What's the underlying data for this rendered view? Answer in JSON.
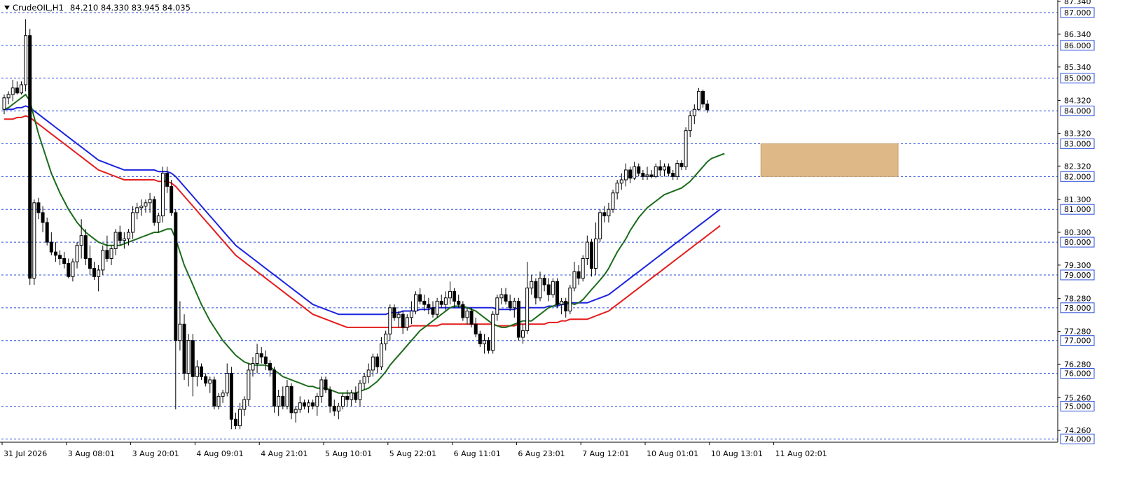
{
  "header": {
    "symbol": "CrudeOIL,H1",
    "ohlc": "84.210 84.330 83.945 84.035"
  },
  "colors": {
    "background": "#ffffff",
    "grid": "#2b4fd6",
    "candle_border": "#000000",
    "bull_body": "#ffffff",
    "bear_body": "#000000",
    "ma_fast": "#1a6b1a",
    "ma_mid": "#1c24e0",
    "ma_slow": "#e51c1c",
    "zone": "#deb887"
  },
  "chart_data": {
    "type": "candlestick",
    "ylim": [
      73.9,
      87.34
    ],
    "y_labels_plain": [
      "87.340",
      "86.340",
      "85.340",
      "84.320",
      "83.320",
      "82.320",
      "81.300",
      "80.300",
      "79.300",
      "78.280",
      "77.280",
      "76.280",
      "75.260",
      "74.260"
    ],
    "y_labels_boxed": [
      "87.000",
      "86.000",
      "85.000",
      "84.000",
      "83.000",
      "82.000",
      "81.000",
      "80.000",
      "79.000",
      "78.000",
      "77.000",
      "76.000",
      "75.000",
      "74.000"
    ],
    "grid_levels": [
      87,
      86,
      85,
      84,
      83,
      82,
      81,
      80,
      79,
      78,
      77,
      76,
      75,
      74
    ],
    "x_labels": [
      "31 Jul 2026",
      "3 Aug 08:01",
      "3 Aug 20:01",
      "4 Aug 09:01",
      "4 Aug 21:01",
      "5 Aug 10:01",
      "5 Aug 22:01",
      "6 Aug 11:01",
      "6 Aug 23:01",
      "7 Aug 12:01",
      "10 Aug 01:01",
      "10 Aug 13:01",
      "11 Aug 02:01"
    ],
    "x_label_bar_index": [
      0,
      15,
      30,
      45,
      60,
      75,
      90,
      105,
      120,
      135,
      150,
      165,
      180
    ],
    "zone": {
      "bar_from": 177,
      "bar_to": 209,
      "low": 82.0,
      "high": 83.0
    },
    "candles": [
      [
        84.05,
        84.5,
        83.9,
        84.4
      ],
      [
        84.4,
        84.6,
        84.2,
        84.5
      ],
      [
        84.5,
        84.95,
        84.3,
        84.7
      ],
      [
        84.7,
        84.9,
        84.5,
        84.55
      ],
      [
        84.55,
        84.9,
        84.5,
        84.8
      ],
      [
        84.8,
        86.8,
        84.6,
        86.3
      ],
      [
        86.3,
        86.5,
        78.7,
        78.9
      ],
      [
        78.9,
        81.3,
        78.7,
        81.2
      ],
      [
        81.2,
        81.35,
        80.7,
        80.9
      ],
      [
        80.9,
        81.1,
        80.3,
        80.6
      ],
      [
        80.6,
        80.75,
        79.9,
        80.0
      ],
      [
        80.0,
        80.3,
        79.6,
        79.7
      ],
      [
        79.7,
        80.0,
        79.4,
        79.6
      ],
      [
        79.6,
        79.75,
        79.3,
        79.5
      ],
      [
        79.5,
        79.7,
        79.2,
        79.35
      ],
      [
        79.35,
        79.5,
        78.9,
        78.95
      ],
      [
        78.95,
        79.5,
        78.8,
        79.4
      ],
      [
        79.4,
        80.0,
        79.2,
        79.9
      ],
      [
        79.9,
        80.7,
        79.5,
        80.2
      ],
      [
        80.2,
        80.4,
        79.3,
        79.5
      ],
      [
        79.5,
        79.9,
        79.0,
        79.2
      ],
      [
        79.2,
        79.4,
        78.85,
        78.95
      ],
      [
        78.95,
        79.3,
        78.5,
        79.15
      ],
      [
        79.15,
        79.9,
        79.0,
        79.75
      ],
      [
        79.75,
        80.2,
        79.4,
        79.5
      ],
      [
        79.5,
        79.9,
        79.3,
        79.8
      ],
      [
        79.8,
        80.4,
        79.6,
        80.3
      ],
      [
        80.3,
        80.5,
        79.9,
        80.05
      ],
      [
        80.05,
        80.3,
        79.8,
        80.1
      ],
      [
        80.1,
        80.4,
        79.9,
        80.3
      ],
      [
        80.3,
        81.1,
        80.1,
        80.9
      ],
      [
        80.9,
        81.2,
        80.7,
        81.05
      ],
      [
        81.05,
        81.3,
        80.8,
        81.1
      ],
      [
        81.1,
        81.3,
        80.9,
        81.2
      ],
      [
        81.2,
        81.5,
        80.9,
        81.3
      ],
      [
        81.3,
        81.4,
        80.5,
        80.6
      ],
      [
        80.6,
        80.9,
        80.3,
        80.8
      ],
      [
        80.8,
        82.3,
        80.6,
        82.1
      ],
      [
        82.1,
        82.3,
        81.5,
        81.7
      ],
      [
        81.7,
        81.9,
        80.8,
        80.9
      ],
      [
        80.9,
        81.0,
        74.9,
        77.0
      ],
      [
        77.0,
        78.2,
        76.7,
        77.5
      ],
      [
        77.5,
        77.8,
        75.8,
        76.0
      ],
      [
        76.0,
        77.2,
        75.6,
        77.0
      ],
      [
        77.0,
        77.2,
        75.3,
        75.9
      ],
      [
        75.9,
        76.4,
        75.6,
        76.2
      ],
      [
        76.2,
        76.3,
        75.8,
        75.9
      ],
      [
        75.9,
        76.0,
        75.6,
        75.7
      ],
      [
        75.7,
        75.9,
        75.4,
        75.8
      ],
      [
        75.8,
        75.9,
        74.9,
        75.0
      ],
      [
        75.0,
        75.4,
        74.9,
        75.3
      ],
      [
        75.3,
        75.5,
        75.1,
        75.4
      ],
      [
        75.4,
        76.3,
        75.3,
        76.0
      ],
      [
        76.0,
        76.2,
        74.3,
        74.6
      ],
      [
        74.6,
        74.8,
        74.3,
        74.4
      ],
      [
        74.4,
        75.1,
        74.3,
        74.9
      ],
      [
        74.9,
        75.3,
        74.7,
        75.2
      ],
      [
        75.2,
        76.3,
        75.0,
        76.1
      ],
      [
        76.1,
        76.5,
        75.9,
        76.3
      ],
      [
        76.3,
        76.9,
        76.0,
        76.6
      ],
      [
        76.6,
        76.8,
        76.3,
        76.5
      ],
      [
        76.5,
        76.7,
        76.1,
        76.3
      ],
      [
        76.3,
        76.4,
        75.9,
        76.1
      ],
      [
        76.1,
        76.2,
        74.8,
        75.0
      ],
      [
        75.0,
        75.5,
        74.7,
        75.3
      ],
      [
        75.3,
        75.6,
        74.9,
        75.0
      ],
      [
        75.0,
        75.8,
        74.9,
        75.6
      ],
      [
        75.6,
        75.7,
        74.6,
        74.8
      ],
      [
        74.8,
        75.0,
        74.5,
        74.9
      ],
      [
        74.9,
        75.3,
        74.8,
        75.1
      ],
      [
        75.1,
        75.2,
        74.9,
        75.0
      ],
      [
        75.0,
        75.2,
        74.8,
        75.1
      ],
      [
        75.1,
        75.2,
        74.9,
        75.0
      ],
      [
        75.0,
        75.4,
        74.7,
        75.3
      ],
      [
        75.3,
        75.9,
        75.1,
        75.8
      ],
      [
        75.8,
        75.9,
        75.4,
        75.5
      ],
      [
        75.5,
        75.6,
        74.8,
        75.0
      ],
      [
        75.0,
        75.2,
        74.7,
        74.85
      ],
      [
        74.85,
        75.1,
        74.6,
        75.0
      ],
      [
        75.0,
        75.4,
        74.9,
        75.3
      ],
      [
        75.3,
        75.5,
        75.0,
        75.2
      ],
      [
        75.2,
        75.5,
        75.0,
        75.4
      ],
      [
        75.4,
        75.6,
        75.1,
        75.2
      ],
      [
        75.2,
        75.8,
        75.0,
        75.7
      ],
      [
        75.7,
        76.0,
        75.5,
        75.9
      ],
      [
        75.9,
        76.3,
        75.7,
        76.1
      ],
      [
        76.1,
        76.6,
        75.9,
        76.5
      ],
      [
        76.5,
        76.6,
        76.0,
        76.2
      ],
      [
        76.2,
        77.1,
        76.1,
        76.9
      ],
      [
        76.9,
        77.3,
        76.7,
        77.2
      ],
      [
        77.2,
        78.1,
        77.0,
        78.0
      ],
      [
        78.0,
        78.1,
        77.6,
        77.7
      ],
      [
        77.7,
        77.9,
        77.4,
        77.8
      ],
      [
        77.8,
        77.9,
        77.2,
        77.4
      ],
      [
        77.4,
        77.8,
        77.3,
        77.7
      ],
      [
        77.7,
        78.2,
        77.5,
        77.9
      ],
      [
        77.9,
        78.5,
        77.8,
        78.4
      ],
      [
        78.4,
        78.6,
        78.1,
        78.2
      ],
      [
        78.2,
        78.4,
        77.9,
        78.1
      ],
      [
        78.1,
        78.3,
        77.8,
        78.0
      ],
      [
        78.0,
        78.2,
        77.7,
        77.8
      ],
      [
        77.8,
        78.3,
        77.7,
        78.2
      ],
      [
        78.2,
        78.4,
        78.0,
        78.1
      ],
      [
        78.1,
        78.5,
        77.9,
        78.3
      ],
      [
        78.3,
        78.8,
        78.1,
        78.5
      ],
      [
        78.5,
        78.6,
        78.0,
        78.2
      ],
      [
        78.2,
        78.4,
        78.0,
        78.1
      ],
      [
        78.1,
        78.2,
        77.6,
        77.7
      ],
      [
        77.7,
        78.0,
        77.5,
        77.9
      ],
      [
        77.9,
        78.0,
        77.4,
        77.5
      ],
      [
        77.5,
        77.7,
        77.1,
        77.2
      ],
      [
        77.2,
        77.3,
        76.8,
        76.9
      ],
      [
        76.9,
        77.2,
        76.6,
        77.0
      ],
      [
        77.0,
        77.1,
        76.6,
        76.7
      ],
      [
        76.7,
        77.9,
        76.6,
        77.8
      ],
      [
        77.8,
        78.4,
        77.6,
        78.3
      ],
      [
        78.3,
        78.6,
        78.1,
        78.4
      ],
      [
        78.4,
        78.6,
        78.1,
        78.2
      ],
      [
        78.2,
        78.4,
        77.9,
        78.0
      ],
      [
        78.0,
        78.3,
        77.7,
        78.2
      ],
      [
        78.2,
        78.3,
        77.0,
        77.1
      ],
      [
        77.1,
        77.5,
        76.9,
        77.3
      ],
      [
        77.3,
        79.4,
        77.2,
        78.6
      ],
      [
        78.6,
        79.0,
        78.4,
        78.8
      ],
      [
        78.8,
        78.9,
        78.1,
        78.3
      ],
      [
        78.3,
        79.1,
        78.2,
        78.9
      ],
      [
        78.9,
        79.0,
        78.5,
        78.7
      ],
      [
        78.7,
        78.9,
        78.2,
        78.4
      ],
      [
        78.4,
        78.9,
        78.3,
        78.8
      ],
      [
        78.8,
        78.9,
        78.0,
        78.1
      ],
      [
        78.1,
        78.3,
        77.8,
        78.2
      ],
      [
        78.2,
        78.3,
        77.7,
        77.9
      ],
      [
        77.9,
        78.7,
        77.8,
        78.6
      ],
      [
        78.6,
        79.4,
        78.5,
        79.1
      ],
      [
        79.1,
        79.3,
        78.7,
        78.9
      ],
      [
        78.9,
        79.6,
        78.8,
        79.5
      ],
      [
        79.5,
        80.2,
        79.3,
        80.0
      ],
      [
        80.0,
        80.1,
        78.95,
        79.2
      ],
      [
        79.2,
        80.6,
        79.0,
        80.1
      ],
      [
        80.1,
        81.0,
        80.0,
        80.9
      ],
      [
        80.9,
        81.1,
        80.6,
        80.8
      ],
      [
        80.8,
        81.2,
        80.6,
        81.0
      ],
      [
        81.0,
        81.6,
        80.9,
        81.5
      ],
      [
        81.5,
        81.9,
        81.3,
        81.8
      ],
      [
        81.8,
        82.1,
        81.6,
        81.9
      ],
      [
        81.9,
        82.4,
        81.7,
        82.2
      ],
      [
        82.2,
        82.3,
        81.8,
        81.95
      ],
      [
        81.95,
        82.45,
        81.9,
        82.3
      ],
      [
        82.3,
        82.4,
        82.0,
        82.1
      ],
      [
        82.1,
        82.2,
        81.9,
        82.0
      ],
      [
        82.0,
        82.3,
        81.9,
        82.05
      ],
      [
        82.05,
        82.2,
        81.95,
        82.0
      ],
      [
        82.0,
        82.4,
        81.95,
        82.3
      ],
      [
        82.3,
        82.5,
        82.0,
        82.2
      ],
      [
        82.2,
        82.4,
        82.0,
        82.3
      ],
      [
        82.3,
        82.4,
        82.0,
        82.1
      ],
      [
        82.1,
        82.2,
        81.9,
        82.0
      ],
      [
        82.0,
        82.5,
        81.9,
        82.4
      ],
      [
        82.4,
        82.5,
        82.2,
        82.3
      ],
      [
        82.3,
        83.5,
        82.2,
        83.4
      ],
      [
        83.4,
        84.0,
        83.2,
        83.85
      ],
      [
        83.85,
        84.2,
        83.6,
        84.05
      ],
      [
        84.05,
        84.7,
        84.0,
        84.6
      ],
      [
        84.6,
        84.65,
        84.1,
        84.21
      ],
      [
        84.21,
        84.33,
        83.945,
        84.035
      ]
    ],
    "ma_fast": [
      84.05,
      84.1,
      84.2,
      84.3,
      84.4,
      84.5,
      84.3,
      83.8,
      83.3,
      82.9,
      82.5,
      82.1,
      81.8,
      81.5,
      81.25,
      81.0,
      80.8,
      80.6,
      80.45,
      80.3,
      80.2,
      80.1,
      80.0,
      79.95,
      79.9,
      79.9,
      79.9,
      79.9,
      79.95,
      80.0,
      80.05,
      80.1,
      80.15,
      80.2,
      80.25,
      80.3,
      80.3,
      80.35,
      80.4,
      80.4,
      80.1,
      79.7,
      79.3,
      79.0,
      78.7,
      78.4,
      78.1,
      77.85,
      77.6,
      77.4,
      77.2,
      77.0,
      76.85,
      76.7,
      76.55,
      76.45,
      76.35,
      76.3,
      76.25,
      76.25,
      76.25,
      76.25,
      76.2,
      76.1,
      76.0,
      75.9,
      75.85,
      75.8,
      75.75,
      75.7,
      75.65,
      75.6,
      75.6,
      75.55,
      75.55,
      75.55,
      75.5,
      75.45,
      75.4,
      75.4,
      75.4,
      75.4,
      75.4,
      75.45,
      75.5,
      75.55,
      75.65,
      75.75,
      75.9,
      76.05,
      76.25,
      76.4,
      76.55,
      76.7,
      76.85,
      77.0,
      77.15,
      77.3,
      77.4,
      77.5,
      77.6,
      77.7,
      77.8,
      77.9,
      78.0,
      78.05,
      78.05,
      78.05,
      78.0,
      77.95,
      77.9,
      77.8,
      77.7,
      77.6,
      77.5,
      77.45,
      77.4,
      77.4,
      77.45,
      77.5,
      77.55,
      77.6,
      77.6,
      77.6,
      77.7,
      77.8,
      77.9,
      78.0,
      78.05,
      78.1,
      78.15,
      78.15,
      78.15,
      78.1,
      78.15,
      78.25,
      78.4,
      78.55,
      78.7,
      78.85,
      79.0,
      79.2,
      79.45,
      79.7,
      79.9,
      80.1,
      80.35,
      80.55,
      80.75,
      80.9,
      81.05,
      81.15,
      81.25,
      81.35,
      81.45,
      81.5,
      81.55,
      81.6,
      81.65,
      81.75,
      81.85,
      82.0,
      82.15,
      82.3,
      82.45,
      82.55,
      82.6,
      82.65,
      82.7
    ],
    "ma_mid": [
      84.05,
      84.05,
      84.05,
      84.1,
      84.1,
      84.15,
      84.1,
      84.0,
      83.9,
      83.8,
      83.7,
      83.6,
      83.5,
      83.4,
      83.3,
      83.2,
      83.1,
      83.0,
      82.9,
      82.8,
      82.7,
      82.6,
      82.5,
      82.45,
      82.4,
      82.35,
      82.3,
      82.25,
      82.2,
      82.2,
      82.2,
      82.2,
      82.2,
      82.2,
      82.2,
      82.2,
      82.15,
      82.15,
      82.15,
      82.1,
      82.0,
      81.85,
      81.7,
      81.55,
      81.4,
      81.25,
      81.1,
      80.95,
      80.8,
      80.65,
      80.5,
      80.35,
      80.2,
      80.05,
      79.9,
      79.8,
      79.7,
      79.6,
      79.5,
      79.4,
      79.3,
      79.2,
      79.1,
      79.0,
      78.9,
      78.8,
      78.7,
      78.6,
      78.5,
      78.4,
      78.3,
      78.2,
      78.1,
      78.05,
      78.0,
      77.95,
      77.9,
      77.85,
      77.8,
      77.8,
      77.8,
      77.8,
      77.8,
      77.8,
      77.8,
      77.8,
      77.8,
      77.8,
      77.8,
      77.8,
      77.85,
      77.85,
      77.85,
      77.9,
      77.9,
      77.9,
      77.9,
      77.95,
      77.95,
      77.95,
      78.0,
      78.0,
      78.0,
      78.0,
      78.0,
      78.0,
      78.0,
      78.0,
      78.0,
      78.0,
      78.0,
      78.0,
      78.0,
      78.0,
      78.0,
      77.95,
      77.95,
      77.95,
      77.95,
      77.95,
      78.0,
      78.0,
      78.0,
      78.0,
      78.0,
      78.0,
      78.0,
      78.05,
      78.05,
      78.05,
      78.1,
      78.1,
      78.15,
      78.15,
      78.15,
      78.15,
      78.15,
      78.2,
      78.25,
      78.3,
      78.35,
      78.4,
      78.5,
      78.6,
      78.7,
      78.8,
      78.9,
      79.0,
      79.1,
      79.2,
      79.3,
      79.4,
      79.5,
      79.6,
      79.7,
      79.8,
      79.9,
      80.0,
      80.1,
      80.2,
      80.3,
      80.4,
      80.5,
      80.6,
      80.7,
      80.8,
      80.9,
      81.0
    ],
    "ma_slow": [
      83.75,
      83.75,
      83.75,
      83.8,
      83.8,
      83.85,
      83.8,
      83.7,
      83.6,
      83.5,
      83.4,
      83.3,
      83.2,
      83.1,
      83.0,
      82.9,
      82.8,
      82.7,
      82.6,
      82.5,
      82.4,
      82.3,
      82.2,
      82.15,
      82.1,
      82.05,
      82.0,
      81.95,
      81.9,
      81.9,
      81.9,
      81.9,
      81.9,
      81.9,
      81.9,
      81.9,
      81.85,
      81.85,
      81.85,
      81.8,
      81.7,
      81.55,
      81.4,
      81.25,
      81.1,
      80.95,
      80.8,
      80.65,
      80.5,
      80.35,
      80.2,
      80.05,
      79.9,
      79.75,
      79.6,
      79.5,
      79.4,
      79.3,
      79.2,
      79.1,
      79.0,
      78.9,
      78.8,
      78.7,
      78.6,
      78.5,
      78.4,
      78.3,
      78.2,
      78.1,
      78.0,
      77.9,
      77.8,
      77.75,
      77.7,
      77.65,
      77.6,
      77.55,
      77.5,
      77.45,
      77.4,
      77.4,
      77.4,
      77.4,
      77.4,
      77.4,
      77.4,
      77.4,
      77.4,
      77.4,
      77.4,
      77.4,
      77.4,
      77.4,
      77.4,
      77.45,
      77.45,
      77.45,
      77.45,
      77.45,
      77.45,
      77.45,
      77.5,
      77.5,
      77.5,
      77.5,
      77.5,
      77.5,
      77.5,
      77.5,
      77.5,
      77.5,
      77.5,
      77.5,
      77.5,
      77.45,
      77.45,
      77.45,
      77.45,
      77.45,
      77.5,
      77.5,
      77.5,
      77.5,
      77.5,
      77.5,
      77.5,
      77.55,
      77.55,
      77.55,
      77.6,
      77.6,
      77.65,
      77.65,
      77.65,
      77.65,
      77.65,
      77.7,
      77.75,
      77.8,
      77.85,
      77.9,
      78.0,
      78.1,
      78.2,
      78.3,
      78.4,
      78.5,
      78.6,
      78.7,
      78.8,
      78.9,
      79.0,
      79.1,
      79.2,
      79.3,
      79.4,
      79.5,
      79.6,
      79.7,
      79.8,
      79.9,
      80.0,
      80.1,
      80.2,
      80.3,
      80.4,
      80.5
    ]
  }
}
